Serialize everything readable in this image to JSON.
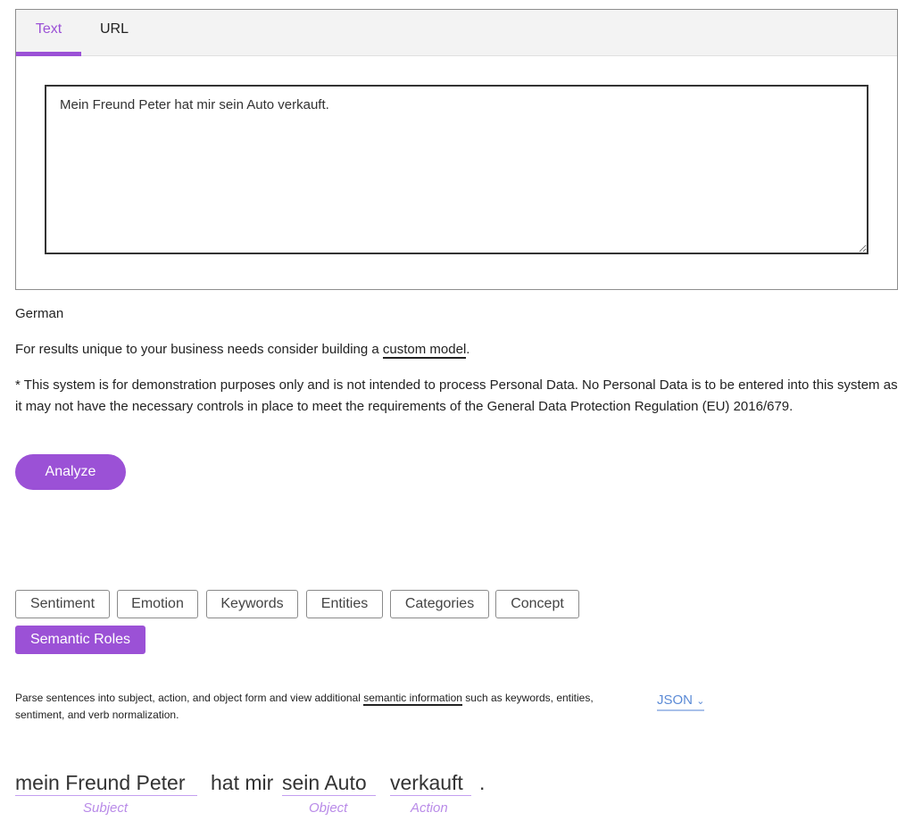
{
  "tabs": [
    {
      "label": "Text",
      "active": true
    },
    {
      "label": "URL",
      "active": false
    }
  ],
  "input": {
    "value": "Mein Freund Peter hat mir sein Auto verkauft."
  },
  "language": "German",
  "custom": {
    "prefix": "For results unique to your business needs consider building a ",
    "link": "custom model",
    "suffix": "."
  },
  "disclaimer": "* This system is for demonstration purposes only and is not intended to process Personal Data. No Personal Data is to be entered into this system as it may not have the necessary controls in place to meet the requirements of the General Data Protection Regulation (EU) 2016/679.",
  "analyze_label": "Analyze",
  "features": [
    {
      "label": "Sentiment"
    },
    {
      "label": "Emotion"
    },
    {
      "label": "Keywords"
    },
    {
      "label": "Entities"
    },
    {
      "label": "Categories"
    },
    {
      "label": "Concept"
    },
    {
      "label": "Semantic Roles",
      "active": true
    }
  ],
  "description": {
    "prefix": "Parse sentences into subject, action, and object form and view additional ",
    "link": "semantic information",
    "suffix": " such as keywords, entities, sentiment, and verb normalization."
  },
  "json_label": "JSON",
  "result": {
    "subject": "mein Freund Peter",
    "between": "hat mir",
    "object": "sein Auto",
    "action": "verkauft",
    "end": ".",
    "subject_label": "Subject",
    "object_label": "Object",
    "action_label": "Action"
  },
  "colors": {
    "accent": "#9b51d6",
    "role_label": "#b98be8",
    "link": "#5b8ad6"
  }
}
